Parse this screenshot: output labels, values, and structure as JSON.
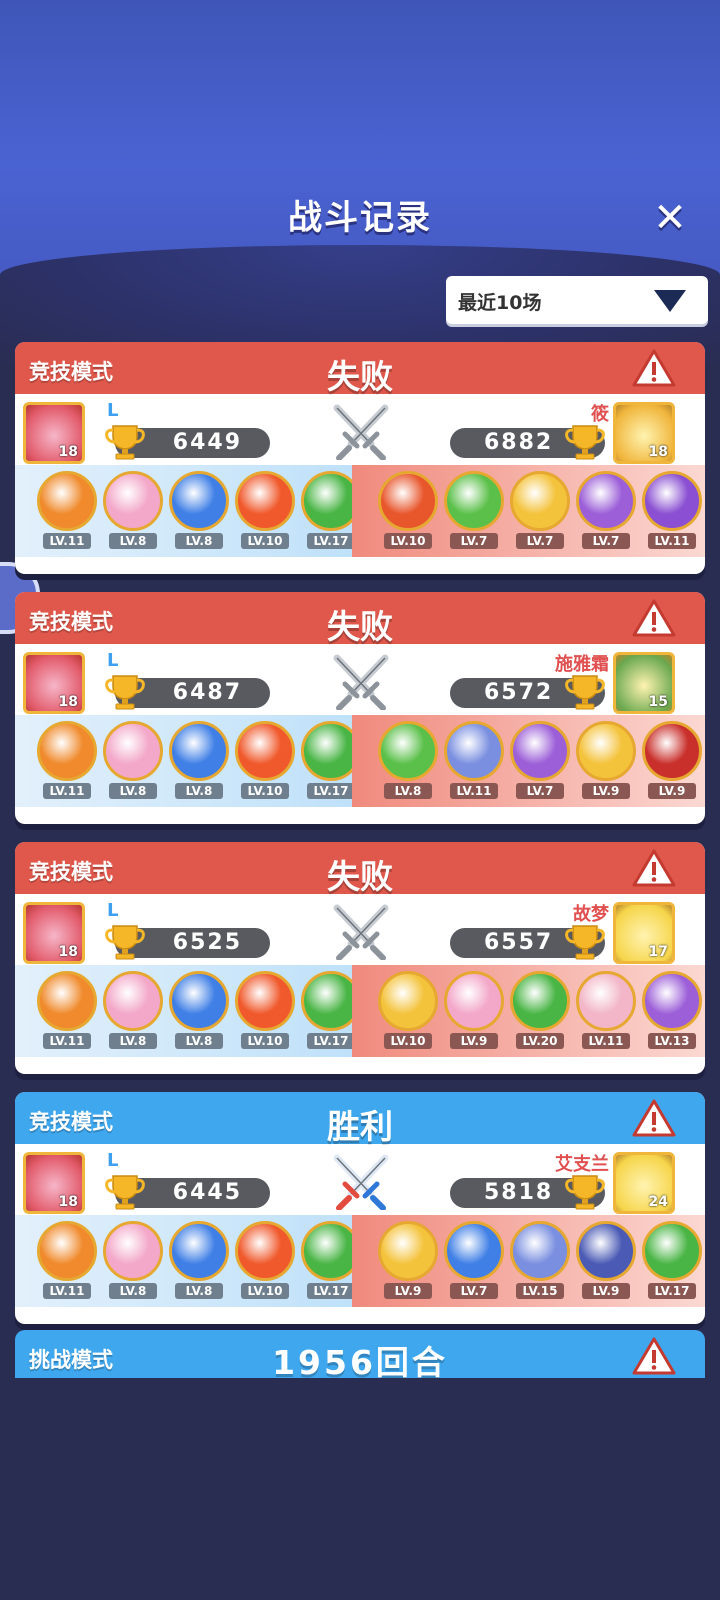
{
  "page": {
    "title": "战斗记录",
    "filter_label": "最近10场"
  },
  "colors": {
    "lose": "#e0584c",
    "win": "#3fa7ee"
  },
  "matches": [
    {
      "mode": "竞技模式",
      "result": "失败",
      "outcome": "lose",
      "me": {
        "name": "L",
        "score": "6449",
        "level": "18",
        "avatar_color": "#e25b6b"
      },
      "enemy": {
        "name": "筱",
        "score": "6882",
        "level": "18",
        "avatar_color": "#f0b53b"
      },
      "my_heroes": [
        {
          "lv": "LV.11",
          "color": "#f08a2c"
        },
        {
          "lv": "LV.8",
          "color": "#f3a8c9"
        },
        {
          "lv": "LV.8",
          "color": "#3f7fe6"
        },
        {
          "lv": "LV.10",
          "color": "#f0592c"
        },
        {
          "lv": "LV.17",
          "color": "#49b545"
        }
      ],
      "enemy_heroes": [
        {
          "lv": "LV.10",
          "color": "#e8562c"
        },
        {
          "lv": "LV.7",
          "color": "#5bc04a"
        },
        {
          "lv": "LV.7",
          "color": "#f4c33c"
        },
        {
          "lv": "LV.7",
          "color": "#9c5fd8"
        },
        {
          "lv": "LV.11",
          "color": "#8a4fd2"
        }
      ]
    },
    {
      "mode": "竞技模式",
      "result": "失败",
      "outcome": "lose",
      "me": {
        "name": "L",
        "score": "6487",
        "level": "18",
        "avatar_color": "#e25b6b"
      },
      "enemy": {
        "name": "施雅霜",
        "score": "6572",
        "level": "15",
        "avatar_color": "#6aa84f"
      },
      "my_heroes": [
        {
          "lv": "LV.11",
          "color": "#f08a2c"
        },
        {
          "lv": "LV.8",
          "color": "#f3a8c9"
        },
        {
          "lv": "LV.8",
          "color": "#3f7fe6"
        },
        {
          "lv": "LV.10",
          "color": "#f0592c"
        },
        {
          "lv": "LV.17",
          "color": "#49b545"
        }
      ],
      "enemy_heroes": [
        {
          "lv": "LV.8",
          "color": "#5bc04a"
        },
        {
          "lv": "LV.11",
          "color": "#7a8fe0"
        },
        {
          "lv": "LV.7",
          "color": "#9c5fd8"
        },
        {
          "lv": "LV.9",
          "color": "#f4c33c"
        },
        {
          "lv": "LV.9",
          "color": "#c9302c"
        }
      ]
    },
    {
      "mode": "竞技模式",
      "result": "失败",
      "outcome": "lose",
      "me": {
        "name": "L",
        "score": "6525",
        "level": "18",
        "avatar_color": "#e25b6b"
      },
      "enemy": {
        "name": "故梦",
        "score": "6557",
        "level": "17",
        "avatar_color": "#f6d54a"
      },
      "my_heroes": [
        {
          "lv": "LV.11",
          "color": "#f08a2c"
        },
        {
          "lv": "LV.8",
          "color": "#f3a8c9"
        },
        {
          "lv": "LV.8",
          "color": "#3f7fe6"
        },
        {
          "lv": "LV.10",
          "color": "#f0592c"
        },
        {
          "lv": "LV.17",
          "color": "#49b545"
        }
      ],
      "enemy_heroes": [
        {
          "lv": "LV.10",
          "color": "#f4c33c"
        },
        {
          "lv": "LV.9",
          "color": "#f3a8c9"
        },
        {
          "lv": "LV.20",
          "color": "#49b545"
        },
        {
          "lv": "LV.11",
          "color": "#f2b6c8"
        },
        {
          "lv": "LV.13",
          "color": "#9c5fd8"
        }
      ]
    },
    {
      "mode": "竞技模式",
      "result": "胜利",
      "outcome": "win",
      "me": {
        "name": "L",
        "score": "6445",
        "level": "18",
        "avatar_color": "#e25b6b"
      },
      "enemy": {
        "name": "艾支兰",
        "score": "5818",
        "level": "24",
        "avatar_color": "#f6d54a"
      },
      "my_heroes": [
        {
          "lv": "LV.11",
          "color": "#f08a2c"
        },
        {
          "lv": "LV.8",
          "color": "#f3a8c9"
        },
        {
          "lv": "LV.8",
          "color": "#3f7fe6"
        },
        {
          "lv": "LV.10",
          "color": "#f0592c"
        },
        {
          "lv": "LV.17",
          "color": "#49b545"
        }
      ],
      "enemy_heroes": [
        {
          "lv": "LV.9",
          "color": "#f4c33c"
        },
        {
          "lv": "LV.7",
          "color": "#3f7fe6"
        },
        {
          "lv": "LV.15",
          "color": "#7a8fe0"
        },
        {
          "lv": "LV.9",
          "color": "#4b5bb5"
        },
        {
          "lv": "LV.17",
          "color": "#49b545"
        }
      ]
    }
  ],
  "challenge": {
    "mode": "挑战模式",
    "rounds": "1956回合"
  }
}
